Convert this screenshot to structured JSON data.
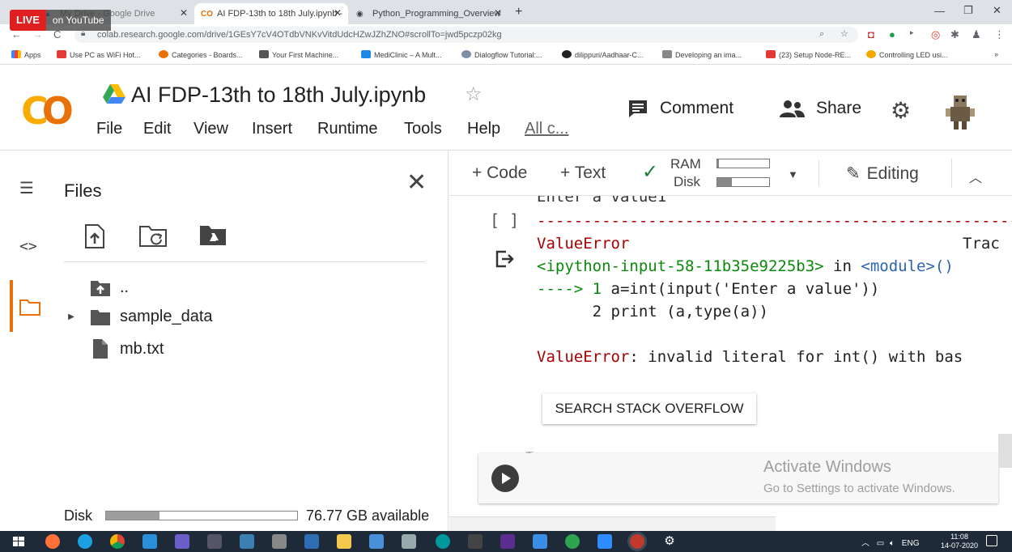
{
  "browser": {
    "tabs": [
      {
        "title": "My Drive - Google Drive"
      },
      {
        "title": "AI FDP-13th to 18th July.ipynb - ",
        "favicon": "CO"
      },
      {
        "title": "Python_Programming_Overview"
      }
    ],
    "live_badge": {
      "live": "LIVE",
      "youtube": "on YouTube"
    },
    "url": "colab.research.google.com/drive/1GEsY7cV4OTdbVNKvVitdUdcHZwJZhZNO#scrollTo=jwd5pczp02kg",
    "bookmarks": [
      "Apps",
      "Use PC as WiFi Hot...",
      "Categories - Boards...",
      "Your First Machine...",
      "MediClinic – A Mult...",
      "Dialogflow Tutorial:...",
      "dilippuri/Aadhaar-C...",
      "Developing an ima...",
      "(23) Setup Node-RE...",
      "Controlling LED usi..."
    ],
    "bookmarks_more": "»"
  },
  "colab": {
    "logo": "CO",
    "title": "AI FDP-13th to 18th July.ipynb",
    "menu": [
      "File",
      "Edit",
      "View",
      "Insert",
      "Runtime",
      "Tools",
      "Help",
      "All c..."
    ],
    "comment_label": "Comment",
    "share_label": "Share"
  },
  "files_panel": {
    "title": "Files",
    "tree": [
      {
        "name": ".."
      },
      {
        "name": "sample_data"
      },
      {
        "name": "mb.txt"
      }
    ],
    "disk_label": "Disk",
    "disk_available": "76.77 GB available",
    "disk_used_fraction": 0.28
  },
  "notebook_toolbar": {
    "code_label": "+ Code",
    "text_label": "+ Text",
    "ram_label": "RAM",
    "disk_label": "Disk",
    "ram_fraction": 0.03,
    "disk_fraction": 0.28,
    "editing_label": "Editing"
  },
  "cell_output": {
    "cut_line": "Enter a value1",
    "bracket": "[ ]",
    "dashes": "---------------------------------------------------------------------------",
    "error_name": "ValueError",
    "traceback_label": "Trac",
    "location_file": "<ipython-input-58-11b35e9225b3>",
    "location_in": " in ",
    "location_module": "<module>()",
    "arrow": "---->",
    "line1_num": " 1 ",
    "line1_code": "a=int(input('Enter a value'))",
    "line2": "      2 print (a,type(a))",
    "error_msg_name": "ValueError",
    "error_msg": ": invalid literal for int() with bas",
    "so_button": "SEARCH STACK OVERFLOW"
  },
  "watermark": {
    "line1": "Activate Windows",
    "line2": "Go to Settings to activate Windows."
  },
  "taskbar": {
    "tray_lang": "ENG",
    "time": "11:08",
    "date": "14-07-2020"
  },
  "colors": {
    "colab_orange": "#e8710a",
    "colab_yellow": "#f9ab00",
    "error_red": "#aa0000",
    "live_red": "#e02020"
  }
}
